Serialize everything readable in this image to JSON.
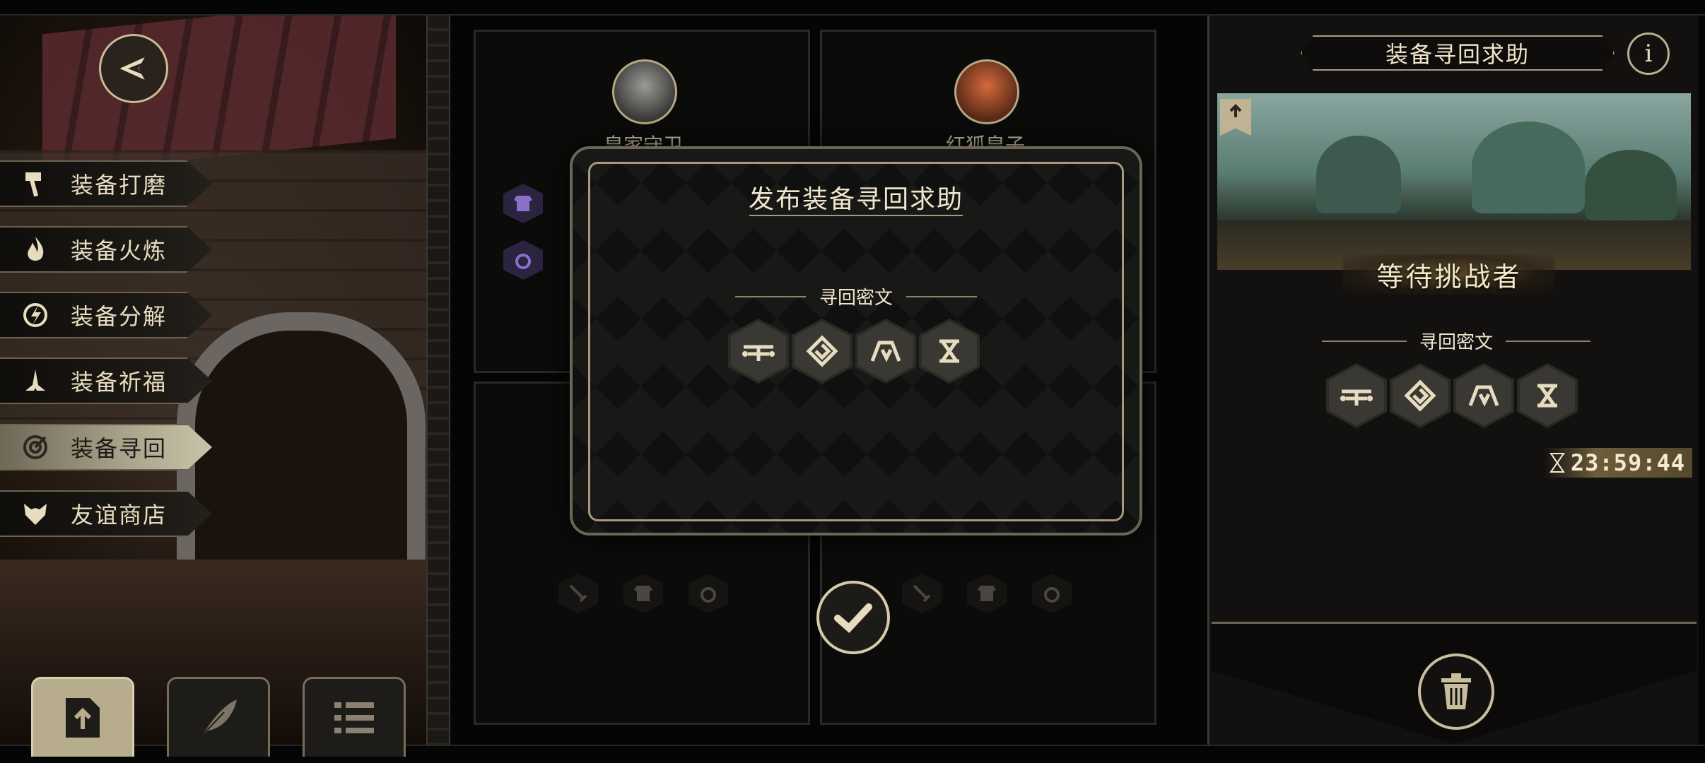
{
  "left_menu": {
    "items": [
      {
        "label": "装备打磨",
        "icon": "hammer-icon",
        "active": false
      },
      {
        "label": "装备火炼",
        "icon": "flame-icon",
        "active": false
      },
      {
        "label": "装备分解",
        "icon": "decompose-icon",
        "active": false
      },
      {
        "label": "装备祈福",
        "icon": "praying-hands-icon",
        "active": false
      },
      {
        "label": "装备寻回",
        "icon": "target-icon",
        "active": true
      },
      {
        "label": "友谊商店",
        "icon": "fox-icon",
        "active": false
      }
    ]
  },
  "characters": [
    {
      "name": "皇家守卫",
      "avatar": "knight-avatar"
    },
    {
      "name": "红狐皇子",
      "avatar": "red-fox-avatar"
    }
  ],
  "dialog": {
    "title": "发布装备寻回求助",
    "section_label": "寻回密文",
    "runes": [
      "rune-1-icon",
      "rune-2-icon",
      "rune-3-icon",
      "rune-4-icon"
    ]
  },
  "right_panel": {
    "title": "装备寻回求助",
    "status": "等待挑战者",
    "section_label": "寻回密文",
    "timer": "23:59:44"
  },
  "colors": {
    "accent_gold": "#c9bb94",
    "active_menu": "#aaa48c",
    "background": "#050505"
  }
}
